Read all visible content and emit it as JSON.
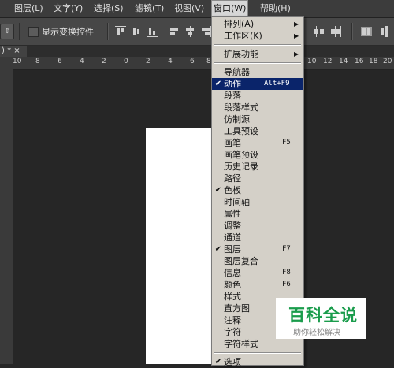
{
  "menubar": {
    "items": [
      "图层(L)",
      "文字(Y)",
      "选择(S)",
      "滤镜(T)",
      "视图(V)",
      "窗口(W)",
      "帮助(H)"
    ],
    "active_index": 5
  },
  "options_bar": {
    "transform_controls_label": "显示变换控件"
  },
  "document_tab": {
    "label": ") * ×"
  },
  "ruler": {
    "labels": [
      "10",
      "8",
      "6",
      "4",
      "2",
      "0",
      "2",
      "4",
      "6",
      "8",
      "10",
      "12",
      "14",
      "16",
      "18",
      "20"
    ]
  },
  "window_menu": {
    "items": [
      {
        "label": "排列(A)",
        "submenu": true
      },
      {
        "label": "工作区(K)",
        "submenu": true
      },
      {
        "separator": true
      },
      {
        "label": "扩展功能",
        "submenu": true
      },
      {
        "separator": true
      },
      {
        "label": "导航器"
      },
      {
        "label": "动作",
        "checked": true,
        "shortcut": "Alt+F9",
        "highlighted": true
      },
      {
        "label": "段落"
      },
      {
        "label": "段落样式"
      },
      {
        "label": "仿制源"
      },
      {
        "label": "工具预设"
      },
      {
        "label": "画笔",
        "shortcut": "F5"
      },
      {
        "label": "画笔预设"
      },
      {
        "label": "历史记录"
      },
      {
        "label": "路径"
      },
      {
        "label": "色板",
        "checked": true
      },
      {
        "label": "时间轴"
      },
      {
        "label": "属性"
      },
      {
        "label": "调整"
      },
      {
        "label": "通道"
      },
      {
        "label": "图层",
        "checked": true,
        "shortcut": "F7"
      },
      {
        "label": "图层复合"
      },
      {
        "label": "信息",
        "shortcut": "F8"
      },
      {
        "label": "颜色",
        "shortcut": "F6"
      },
      {
        "label": "样式"
      },
      {
        "label": "直方图"
      },
      {
        "label": "注释"
      },
      {
        "label": "字符"
      },
      {
        "label": "字符样式"
      },
      {
        "separator": true
      },
      {
        "label": "选项",
        "checked": true
      }
    ]
  },
  "watermark": {
    "title": "百科全说",
    "subtitle": "助你轻松解决"
  }
}
